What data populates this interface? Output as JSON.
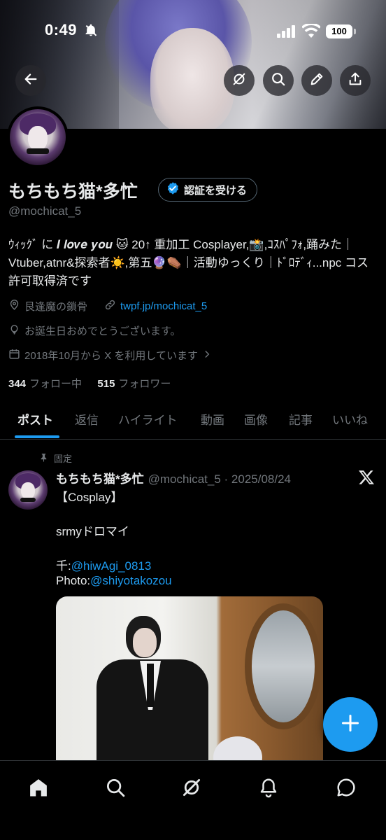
{
  "status_bar": {
    "time": "0:49",
    "battery": "100"
  },
  "header": {
    "icons": [
      "back-arrow-icon",
      "grok-icon",
      "search-icon",
      "edit-pencil-icon",
      "share-icon"
    ]
  },
  "profile": {
    "display_name": "もちもち猫*多忙",
    "verify_label": "認証を受ける",
    "handle": "@mochicat_5",
    "bio": "ｳｨｯｸﾞ に 𝑰 𝒍𝒐𝒗𝒆 𝒚𝒐𝒖 🐱 20↑ 重加工 Cosplayer,📸,ｺｽﾊﾟﾌｫ,踊みた｜Vtuber,atnr&探索者☀️,第五🔮⚰️｜活動ゆっくり｜ﾄﾞﾛﾃﾞｨ...npc コス許可取得済です",
    "location": "艮逢魔の鎖骨",
    "website": "twpf.jp/mochicat_5",
    "birthday": "お誕生日おめでとうございます。",
    "joined": "2018年10月から X を利用しています",
    "following_count": "344",
    "following_label": "フォロー中",
    "followers_count": "515",
    "followers_label": "フォロワー"
  },
  "tabs": [
    {
      "label": "ポスト",
      "active": true
    },
    {
      "label": "返信"
    },
    {
      "label": "ハイライト"
    },
    {
      "label": "動画"
    },
    {
      "label": "画像"
    },
    {
      "label": "記事"
    },
    {
      "label": "いいね"
    }
  ],
  "pinned_post": {
    "pinned_label": "固定",
    "author_name": "もちもち猫*多忙",
    "author_meta": "@mochicat_5 · 2025/08/24",
    "line1": "【Cosplay】",
    "line2": "srmyドロマイ",
    "line3_prefix": "千:",
    "line3_mention": "@hiwAgi_0813",
    "line4_prefix": "Photo:",
    "line4_mention": "@shiyotakozou"
  },
  "colors": {
    "accent": "#1d9bf0",
    "background": "#000000",
    "text_primary": "#e7e9ea",
    "text_secondary": "#71767b",
    "border": "#2f3336"
  },
  "bottom_nav": {
    "icons": [
      "home-icon",
      "search-icon",
      "grok-icon",
      "notifications-bell-icon",
      "messages-icon"
    ]
  }
}
